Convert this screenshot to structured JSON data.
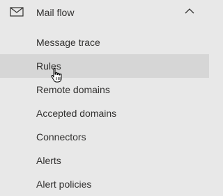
{
  "section": {
    "title": "Mail flow",
    "icon": "mail-icon",
    "toggle_icon": "chevron-up-icon",
    "expanded": true
  },
  "items": [
    {
      "label": "Message trace",
      "selected": false
    },
    {
      "label": "Rules",
      "selected": true
    },
    {
      "label": "Remote domains",
      "selected": false
    },
    {
      "label": "Accepted domains",
      "selected": false
    },
    {
      "label": "Connectors",
      "selected": false
    },
    {
      "label": "Alerts",
      "selected": false
    },
    {
      "label": "Alert policies",
      "selected": false
    }
  ],
  "colors": {
    "background": "#e8e8e8",
    "selected_background": "#d6d6d6",
    "text": "#323130"
  },
  "cursor": {
    "icon": "hand-pointer-icon"
  }
}
